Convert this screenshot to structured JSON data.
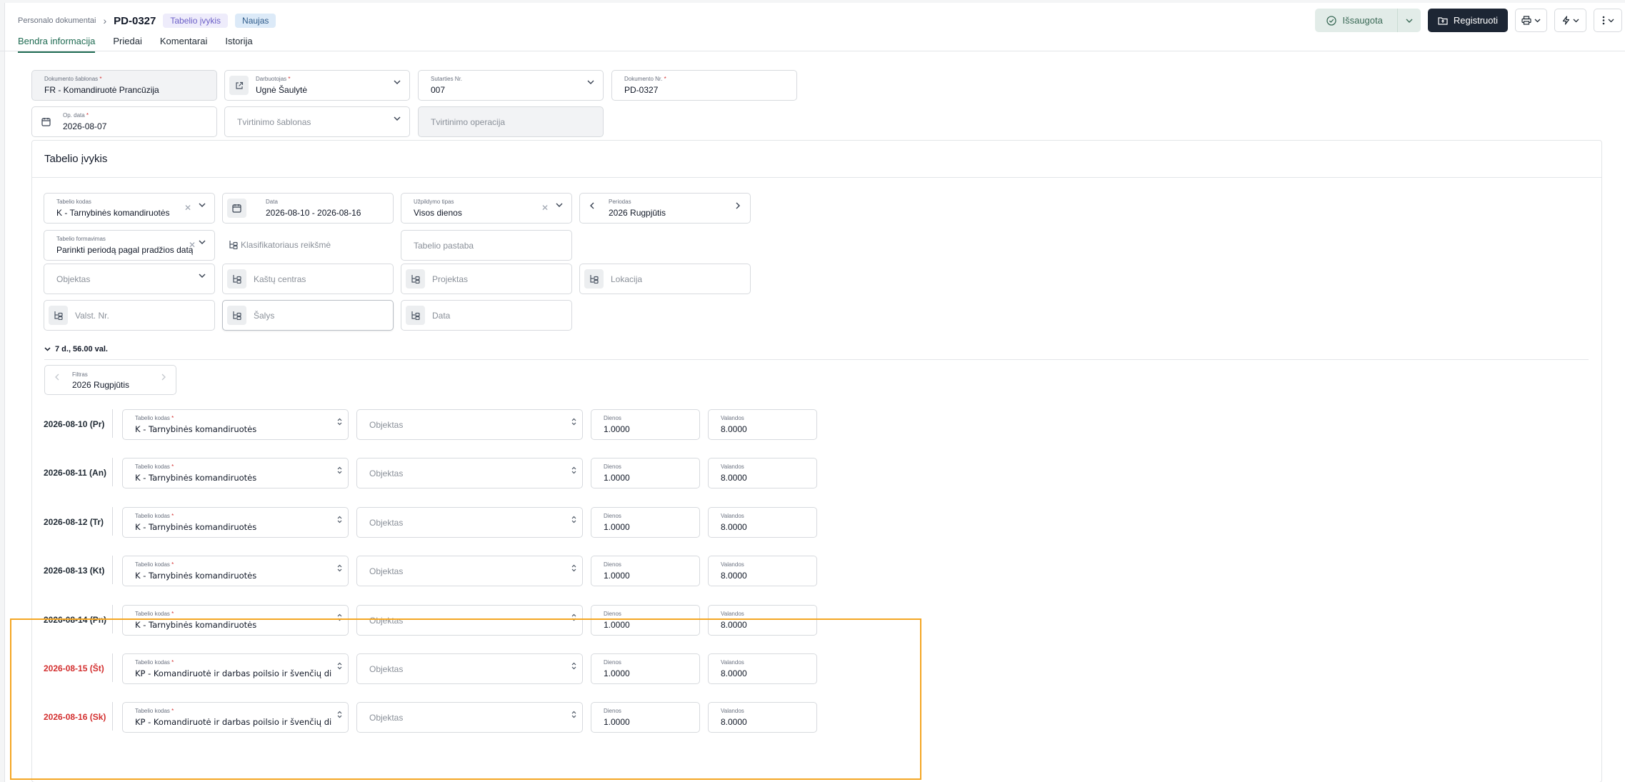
{
  "breadcrumb": {
    "parent": "Personalo dokumentai",
    "title": "PD-0327",
    "badge_type": "Tabelio įvykis",
    "badge_status": "Naujas"
  },
  "tabs": [
    {
      "label": "Bendra informacija",
      "active": true
    },
    {
      "label": "Priedai",
      "active": false
    },
    {
      "label": "Komentarai",
      "active": false
    },
    {
      "label": "Istorija",
      "active": false
    }
  ],
  "actions": {
    "saved_label": "Išsaugota",
    "register_label": "Registruoti"
  },
  "header_form": {
    "template": {
      "label": "Dokumento šablonas",
      "value": "FR - Komandiruotė Prancūzija"
    },
    "employee": {
      "label": "Darbuotojas",
      "value": "Ugnė Šaulytė"
    },
    "contract": {
      "label": "Sutarties Nr.",
      "value": "007"
    },
    "doc_number": {
      "label": "Dokumento Nr.",
      "value": "PD-0327"
    },
    "op_date": {
      "label": "Op. data",
      "value": "2026-08-07"
    },
    "approval_template": {
      "placeholder": "Tvirtinimo šablonas"
    },
    "approval_operation": {
      "placeholder": "Tvirtinimo operacija"
    }
  },
  "event_card": {
    "title": "Tabelio įvykis",
    "code": {
      "label": "Tabelio kodas",
      "value": "K - Tarnybinės komandiruotės"
    },
    "date": {
      "label": "Data",
      "value": "2026-08-10 - 2026-08-16"
    },
    "fill_type": {
      "label": "Užpildymo tipas",
      "value": "Visos dienos"
    },
    "period": {
      "label": "Periodas",
      "value": "2026 Rugpjūtis"
    },
    "formation": {
      "label": "Tabelio formavimas",
      "value": "Parinkti periodą pagal pradžios datą"
    },
    "classifier": {
      "placeholder": "Klasifikatoriaus reikšmė"
    },
    "note": {
      "placeholder": "Tabelio pastaba"
    },
    "object": {
      "placeholder": "Objektas"
    },
    "cost_center": {
      "placeholder": "Kaštų centras"
    },
    "project": {
      "placeholder": "Projektas"
    },
    "location": {
      "placeholder": "Lokacija"
    },
    "plate": {
      "placeholder": "Valst. Nr."
    },
    "country": {
      "placeholder": "Šalys"
    },
    "date2": {
      "placeholder": "Data"
    }
  },
  "summary": "7 d., 56.00 val.",
  "filter": {
    "label": "Filtras",
    "value": "2026 Rugpjūtis"
  },
  "row_labels": {
    "code": "Tabelio kodas",
    "object": "Objektas",
    "days": "Dienos",
    "hours": "Valandos"
  },
  "rows": [
    {
      "date": "2026-08-10 (Pr)",
      "code": "K - Tarnybinės komandiruotės",
      "days": "1.0000",
      "hours": "8.0000",
      "weekend": false
    },
    {
      "date": "2026-08-11 (An)",
      "code": "K - Tarnybinės komandiruotės",
      "days": "1.0000",
      "hours": "8.0000",
      "weekend": false
    },
    {
      "date": "2026-08-12 (Tr)",
      "code": "K - Tarnybinės komandiruotės",
      "days": "1.0000",
      "hours": "8.0000",
      "weekend": false
    },
    {
      "date": "2026-08-13 (Kt)",
      "code": "K - Tarnybinės komandiruotės",
      "days": "1.0000",
      "hours": "8.0000",
      "weekend": false
    },
    {
      "date": "2026-08-14 (Pn)",
      "code": "K - Tarnybinės komandiruotės",
      "days": "1.0000",
      "hours": "8.0000",
      "weekend": false
    },
    {
      "date": "2026-08-15 (Št)",
      "code": "KP - Komandiruotė ir darbas poilsio ir švenčių dienomis",
      "days": "1.0000",
      "hours": "8.0000",
      "weekend": true
    },
    {
      "date": "2026-08-16 (Sk)",
      "code": "KP - Komandiruotė ir darbas poilsio ir švenčių dienomis",
      "days": "1.0000",
      "hours": "8.0000",
      "weekend": true
    }
  ],
  "colors": {
    "accent": "#1f6b52",
    "dark": "#1d2634",
    "weekend": "#d32f2f",
    "highlight": "#f4a623"
  }
}
